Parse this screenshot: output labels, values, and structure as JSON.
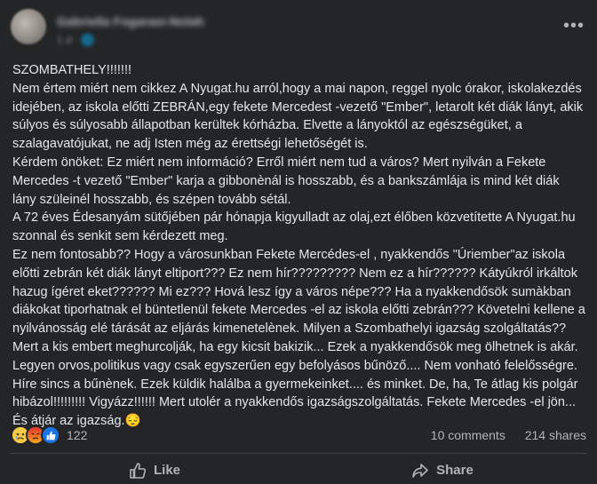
{
  "post": {
    "author": "Gabriella Fogarasi-Nolah",
    "meta": "1 d · 🌐",
    "more_icon": "•••",
    "text": "SZOMBATHELY!!!!!!!\nNem értem miért nem cikkez A Nyugat.hu arról,hogy a mai napon, reggel nyolc órakor, iskolakezdés idejében, az iskola előtti ZEBRÁN,egy fekete Mercedest -vezető \"Ember\", letarolt két diák lányt, akik súlyos és súlyosabb állapotban kerültek kórházba. Elvette a lányoktól az egészségüket, a szalagavatójukat, ne adj Isten még az érettségi lehetőségét is.\nKérdem önöket: Ez miért nem információ? Erről miért nem tud a város? Mert nyilván a Fekete Mercedes -t vezető \"Ember\" karja a gibbonènál is hosszabb, és a bankszámlája is mind két diák lány szüleinél hosszabb, és szépen tovább sétál.\nA 72 éves Édesanyám sütőjében pár hónapja kigyulladt az olaj,ezt élőben közvetítette A Nyugat.hu szonnal és senkit sem kérdezett meg.\nEz nem fontosabb?? Hogy a városunkban Fekete Mercédes-el , nyakkendős \"Úriember\"az iskola előtti zebrán két diák lányt eltiport??? Ez nem hír????????? Nem ez a hír?????? Kátyúkról irkáltok hazug ígéret eket?????? Mi ez??? Hová lesz így a város népe??? Ha a nyakkendősök sumàkban diákokat tiporhatnak el büntetlenül fekete Mercedes -el az iskola előtti zebrán??? Követelni kellene a nyilvánosság elé tárását az eljárás kimenetelènek. Milyen a Szombathelyi igazság szolgáltatás?? Mert a kis embert meghurcolják, ha egy kicsit bakizik... Ezek a nyakkendősök meg ölhetnek is akár. Legyen orvos,politikus vagy csak egyszerűen egy befolyásos bűnöző.... Nem vonható felelősségre. Híre sincs a bűnènek. Ezek küldik halálba a gyermekeinket.... és minket. De, ha, Te átlag kis polgár hibázol!!!!!!!!! Vigyázz!!!!!! Mert utolér a nyakkendős igazságszolgáltatás. Fekete Mercedes -el jön... És átjár az igazság.😔"
  },
  "reactions": {
    "icons": [
      "sad-reaction-icon",
      "angry-reaction-icon",
      "like-reaction-icon"
    ],
    "count": "122"
  },
  "engagement": {
    "comments": "10 comments",
    "shares": "214 shares"
  },
  "actions": {
    "like_label": "Like",
    "share_label": "Share"
  },
  "colors": {
    "background": "#242526",
    "text_primary": "#e4e6eb",
    "text_secondary": "#b0b3b8",
    "like_blue": "#1b74e4",
    "divider": "#3e4042"
  }
}
